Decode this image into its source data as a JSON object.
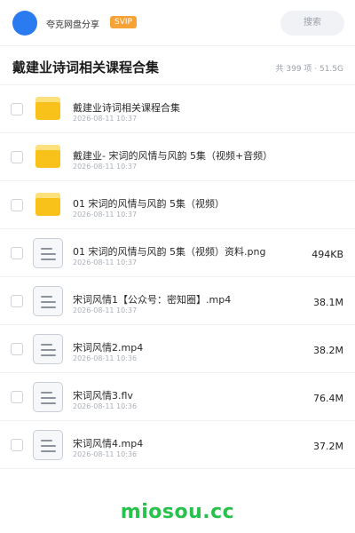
{
  "header": {
    "username": "夸克网盘分享",
    "badge": "SVIP",
    "search_placeholder": "搜索",
    "avatar_color": "#2b7bf0"
  },
  "folder": {
    "title": "戴建业诗词相关课程合集",
    "summary": "共 399 项 · 51.5G"
  },
  "files": [
    {
      "type": "folder",
      "name": "戴建业诗词相关课程合集",
      "date": "2026-08-11 10:37",
      "size": ""
    },
    {
      "type": "folder",
      "name": "戴建业- 宋词的风情与风韵 5集（视频+音频）",
      "date": "2026-08-11 10:37",
      "size": ""
    },
    {
      "type": "folder",
      "name": "01 宋词的风情与风韵 5集（视频）",
      "date": "2026-08-11 10:37",
      "size": ""
    },
    {
      "type": "file",
      "name": "01 宋词的风情与风韵 5集（视频）资料.png",
      "date": "2026-08-11 10:37",
      "size": "494KB"
    },
    {
      "type": "file",
      "name": "宋词风情1【公众号：密知圈】.mp4",
      "date": "2026-08-11 10:37",
      "size": "38.1M"
    },
    {
      "type": "file",
      "name": "宋词风情2.mp4",
      "date": "2026-08-11 10:36",
      "size": "38.2M"
    },
    {
      "type": "file",
      "name": "宋词风情3.flv",
      "date": "2026-08-11 10:36",
      "size": "76.4M"
    },
    {
      "type": "file",
      "name": "宋词风情4.mp4",
      "date": "2026-08-11 10:36",
      "size": "37.2M"
    }
  ],
  "footer": {
    "brand": "miosou.cc",
    "brand_color": "#27c24c"
  },
  "colors": {
    "folder_yellow": "#f9c21a",
    "svip_orange": "#f7a235"
  }
}
